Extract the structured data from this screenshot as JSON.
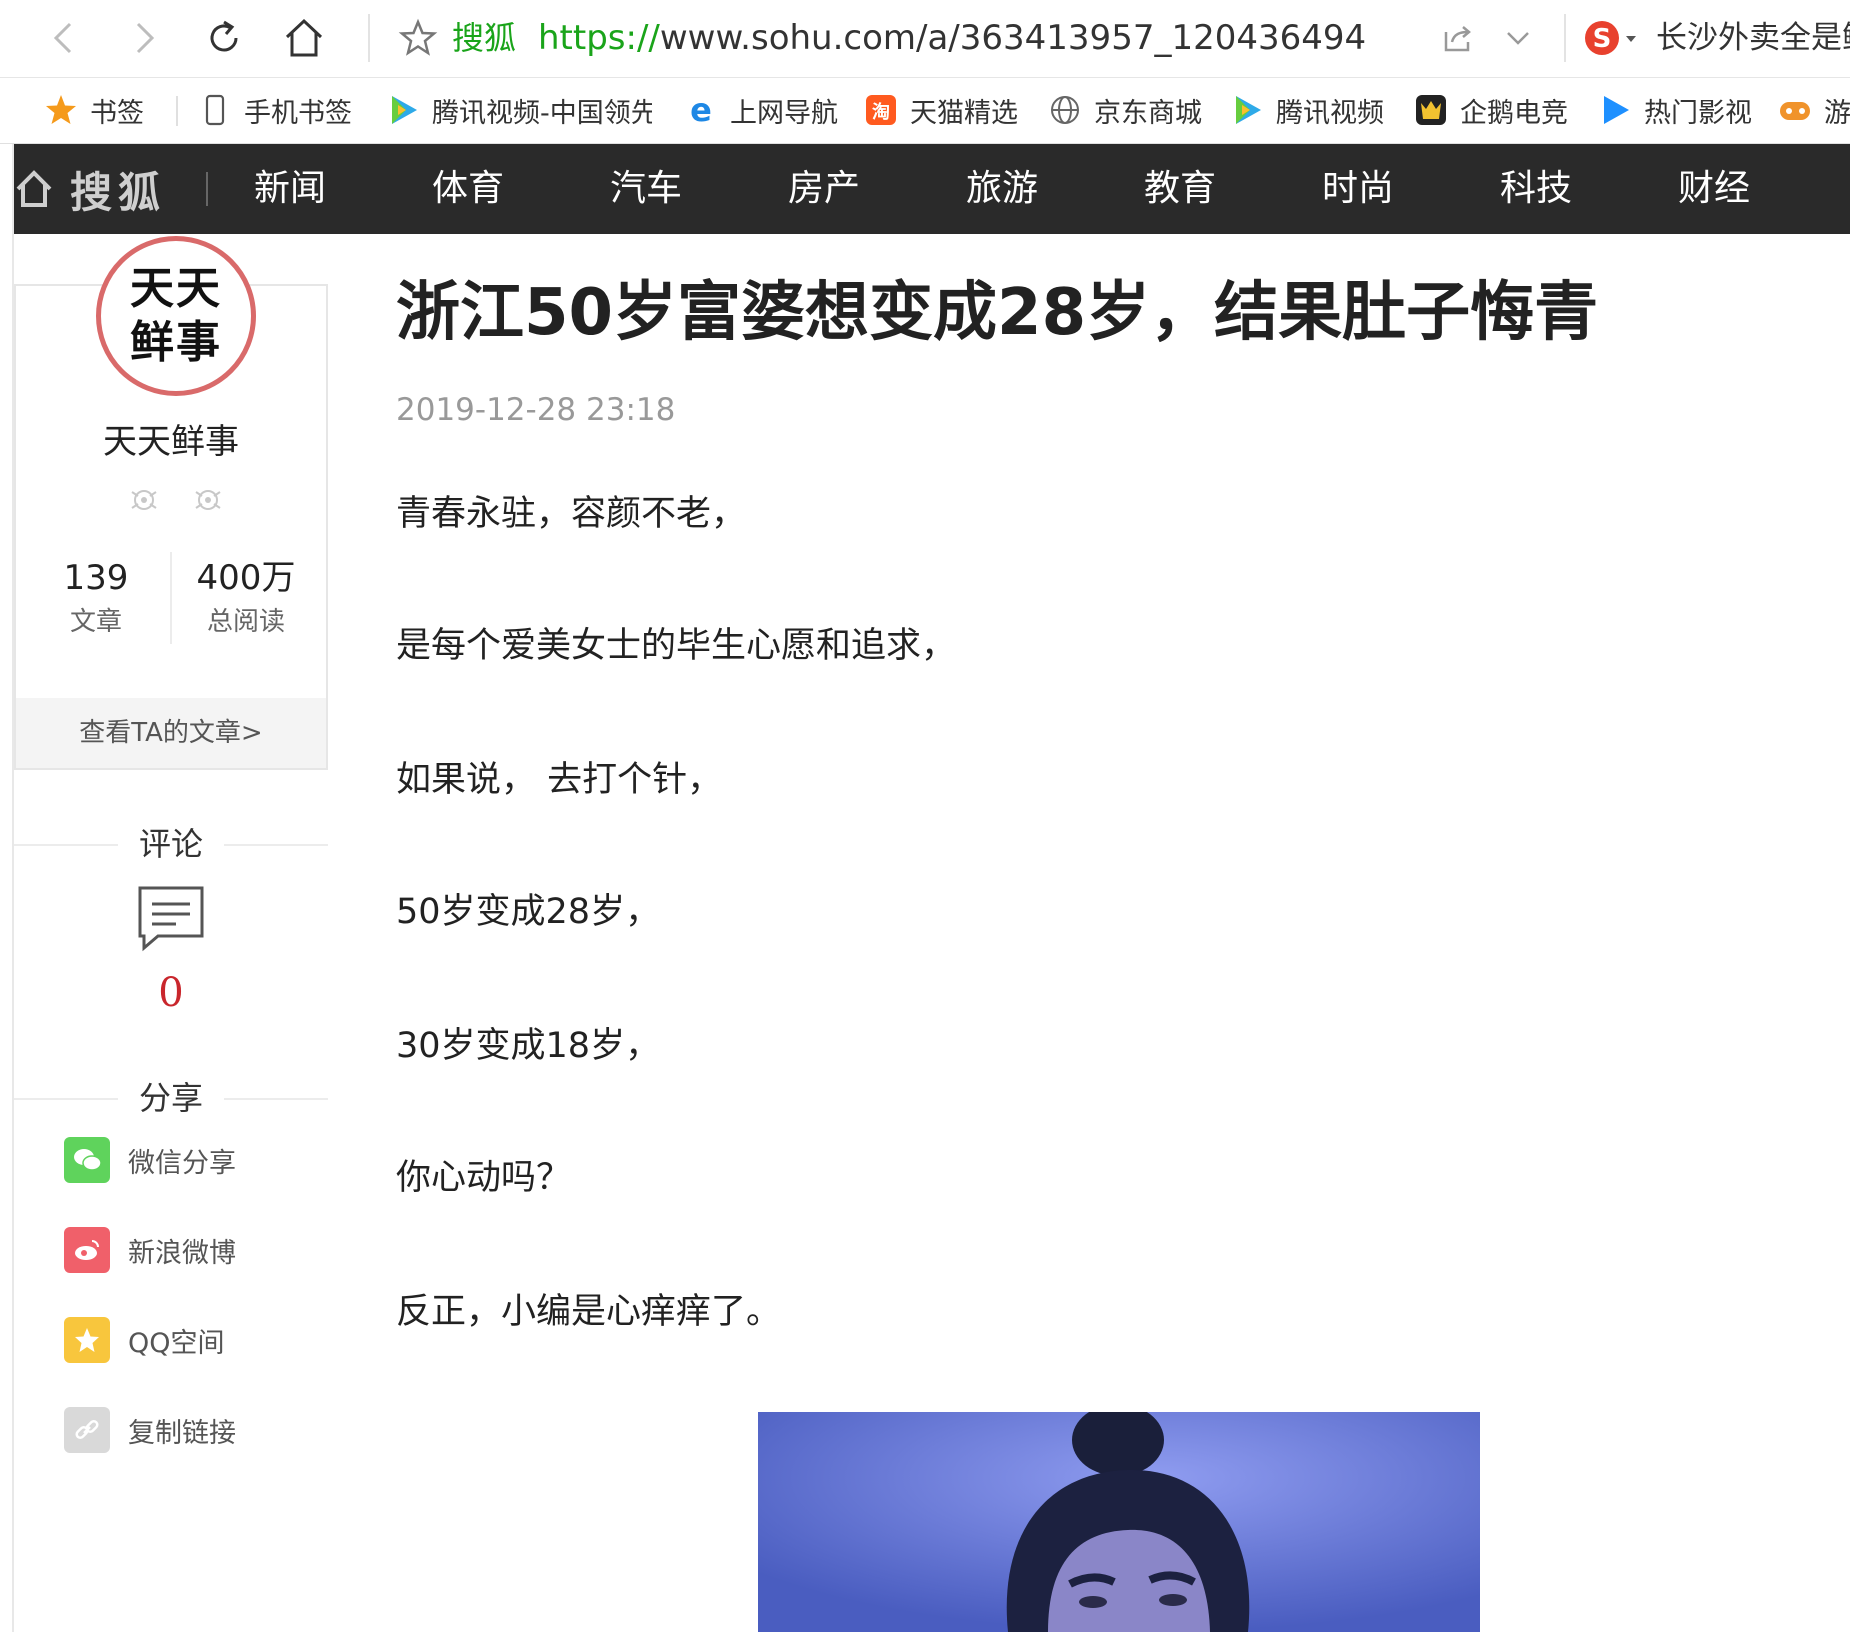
{
  "browser": {
    "site_name": "搜狐",
    "url_scheme": "https://",
    "url_rest": "www.sohu.com/a/363413957_120436494",
    "search_text": "长沙外卖全是鲜"
  },
  "bookmarks": [
    {
      "label": "书签",
      "icon": "star-icon"
    },
    {
      "label": "手机书签",
      "icon": "phone-icon"
    },
    {
      "label": "腾讯视频-中国领先",
      "icon": "tencent-video-icon"
    },
    {
      "label": "上网导航",
      "icon": "ie-icon"
    },
    {
      "label": "天猫精选",
      "icon": "tmall-icon"
    },
    {
      "label": "京东商城",
      "icon": "globe-icon"
    },
    {
      "label": "腾讯视频",
      "icon": "tencent-video-icon"
    },
    {
      "label": "企鹅电竞",
      "icon": "penguin-esports-icon"
    },
    {
      "label": "热门影视",
      "icon": "play-icon"
    },
    {
      "label": "游",
      "icon": "gamepad-icon"
    }
  ],
  "site_nav": {
    "logo": "搜狐",
    "items": [
      "新闻",
      "体育",
      "汽车",
      "房产",
      "旅游",
      "教育",
      "时尚",
      "科技",
      "财经"
    ]
  },
  "author": {
    "avatar_line1": "天天",
    "avatar_line2": "鲜事",
    "name": "天天鲜事",
    "articles_count": "139",
    "articles_label": "文章",
    "reads_count": "400万",
    "reads_label": "总阅读",
    "view_articles": "查看TA的文章>"
  },
  "comments": {
    "heading": "评论",
    "count": "0"
  },
  "share": {
    "heading": "分享",
    "items": [
      {
        "label": "微信分享",
        "icon": "wechat-icon",
        "color": "#5fd35c"
      },
      {
        "label": "新浪微博",
        "icon": "weibo-icon",
        "color": "#f0606a"
      },
      {
        "label": "QQ空间",
        "icon": "qzone-icon",
        "color": "#f8c63d"
      },
      {
        "label": "复制链接",
        "icon": "link-icon",
        "color": "#d9d9d9"
      }
    ]
  },
  "article": {
    "title": "浙江50岁富婆想变成28岁，结果肚子悔青",
    "date": "2019-12-28 23:18",
    "paragraphs": [
      "青春永驻，容颜不老，",
      "是每个爱美女士的毕生心愿和追求，",
      "如果说， 去打个针，",
      "50岁变成28岁，",
      "30岁变成18岁，",
      "你心动吗？",
      "反正，小编是心痒痒了。"
    ]
  }
}
